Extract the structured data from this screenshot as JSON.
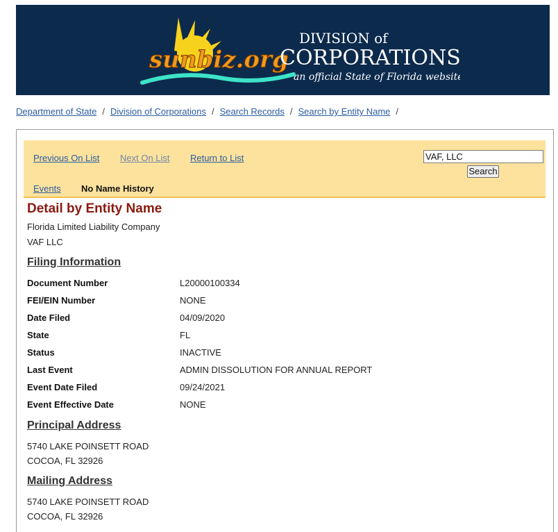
{
  "header": {
    "logo_text": "sunbiz.org",
    "division_line1": "DIVISION of",
    "division_line2": "CORPORATIONS",
    "tagline": "an official State of Florida website"
  },
  "breadcrumb": [
    "Department of State",
    "Division of Corporations",
    "Search Records",
    "Search by Entity Name"
  ],
  "breadcrumb_sep": "/",
  "navbar": {
    "previous": "Previous On List",
    "next": "Next On List",
    "return": "Return to List",
    "events": "Events",
    "name_history": "No Name History",
    "search_value": "VAF, LLC",
    "search_button": "Search"
  },
  "detail": {
    "title": "Detail by Entity Name",
    "entity_type": "Florida Limited Liability Company",
    "entity_name": "VAF LLC"
  },
  "filing": {
    "heading": "Filing Information",
    "rows": [
      {
        "label": "Document Number",
        "value": "L20000100334"
      },
      {
        "label": "FEI/EIN Number",
        "value": "NONE"
      },
      {
        "label": "Date Filed",
        "value": "04/09/2020"
      },
      {
        "label": "State",
        "value": "FL"
      },
      {
        "label": "Status",
        "value": "INACTIVE"
      },
      {
        "label": "Last Event",
        "value": "ADMIN DISSOLUTION FOR ANNUAL REPORT"
      },
      {
        "label": "Event Date Filed",
        "value": "09/24/2021"
      },
      {
        "label": "Event Effective Date",
        "value": "NONE"
      }
    ]
  },
  "principal_address": {
    "heading": "Principal Address",
    "line1": "5740 LAKE POINSETT ROAD",
    "line2": "COCOA, FL 32926"
  },
  "mailing_address": {
    "heading": "Mailing Address",
    "line1": "5740 LAKE POINSETT ROAD",
    "line2": "COCOA, FL 32926"
  },
  "colors": {
    "header_bg": "#0c2a4c",
    "navbar_bg": "#fde29e",
    "title": "#8b1a10",
    "link": "#2a5d9f"
  }
}
